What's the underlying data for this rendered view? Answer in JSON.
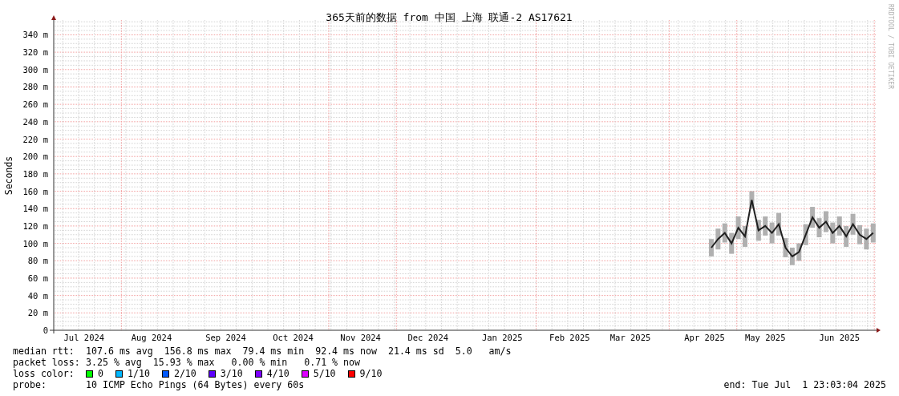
{
  "chart": {
    "watermark": "RRDTOOL / TOBI OETIKER",
    "chart_data": {
      "type": "line",
      "title": "365天前的数据 from 中国 上海 联通-2 AS17621",
      "ylabel": "Seconds",
      "ylim": [
        0,
        357
      ],
      "grid": true,
      "categories": [
        null,
        null,
        null,
        null,
        "Jul 2024",
        null,
        null,
        null,
        null,
        null,
        null,
        null,
        null,
        null,
        "Aug 2024",
        null,
        null,
        null,
        null,
        null,
        null,
        null,
        null,
        null,
        null,
        "Sep 2024",
        null,
        null,
        null,
        null,
        null,
        null,
        null,
        null,
        null,
        "Oct 2024",
        null,
        null,
        null,
        null,
        null,
        null,
        null,
        null,
        null,
        "Nov 2024",
        null,
        null,
        null,
        null,
        null,
        null,
        null,
        null,
        null,
        "Dec 2024",
        null,
        null,
        null,
        null,
        null,
        null,
        null,
        null,
        null,
        null,
        "Jan 2025",
        null,
        null,
        null,
        null,
        null,
        null,
        null,
        null,
        null,
        "Feb 2025",
        null,
        null,
        null,
        null,
        null,
        null,
        null,
        null,
        "Mar 2025",
        null,
        null,
        null,
        null,
        null,
        null,
        null,
        null,
        null,
        null,
        "Apr 2025",
        null,
        null,
        null,
        null,
        null,
        null,
        null,
        null,
        "May 2025",
        null,
        null,
        null,
        null,
        null,
        null,
        null,
        null,
        null,
        null,
        "Jun 2025",
        null,
        null,
        null,
        null,
        null
      ],
      "yticks": [
        {
          "value": 0,
          "label": "0"
        },
        {
          "value": 20,
          "label": "20 m"
        },
        {
          "value": 40,
          "label": "40 m"
        },
        {
          "value": 60,
          "label": "60 m"
        },
        {
          "value": 80,
          "label": "80 m"
        },
        {
          "value": 100,
          "label": "100 m"
        },
        {
          "value": 120,
          "label": "120 m"
        },
        {
          "value": 140,
          "label": "140 m"
        },
        {
          "value": 160,
          "label": "160 m"
        },
        {
          "value": 180,
          "label": "180 m"
        },
        {
          "value": 200,
          "label": "200 m"
        },
        {
          "value": 220,
          "label": "220 m"
        },
        {
          "value": 240,
          "label": "240 m"
        },
        {
          "value": 260,
          "label": "260 m"
        },
        {
          "value": 280,
          "label": "280 m"
        },
        {
          "value": 300,
          "label": "300 m"
        },
        {
          "value": 320,
          "label": "320 m"
        },
        {
          "value": 340,
          "label": "340 m"
        }
      ],
      "series": [
        {
          "color": "#202020",
          "values": [
            null,
            null,
            null,
            null,
            null,
            null,
            null,
            null,
            null,
            null,
            null,
            null,
            null,
            null,
            null,
            null,
            null,
            null,
            null,
            null,
            null,
            null,
            null,
            null,
            null,
            null,
            null,
            null,
            null,
            null,
            null,
            null,
            null,
            null,
            null,
            null,
            null,
            null,
            null,
            null,
            null,
            null,
            null,
            null,
            null,
            null,
            null,
            null,
            null,
            null,
            null,
            null,
            null,
            null,
            null,
            null,
            null,
            null,
            null,
            null,
            null,
            null,
            null,
            null,
            null,
            null,
            null,
            null,
            null,
            null,
            null,
            null,
            null,
            null,
            null,
            null,
            null,
            null,
            null,
            null,
            null,
            null,
            null,
            null,
            null,
            null,
            null,
            null,
            null,
            null,
            null,
            null,
            null,
            null,
            null,
            null,
            null,
            95,
            105,
            112,
            100,
            118,
            108,
            150,
            115,
            120,
            112,
            122,
            95,
            85,
            90,
            110,
            130,
            118,
            125,
            112,
            120,
            108,
            122,
            110,
            105,
            112
          ],
          "errors": [
            null,
            null,
            null,
            null,
            null,
            null,
            null,
            null,
            null,
            null,
            null,
            null,
            null,
            null,
            null,
            null,
            null,
            null,
            null,
            null,
            null,
            null,
            null,
            null,
            null,
            null,
            null,
            null,
            null,
            null,
            null,
            null,
            null,
            null,
            null,
            null,
            null,
            null,
            null,
            null,
            null,
            null,
            null,
            null,
            null,
            null,
            null,
            null,
            null,
            null,
            null,
            null,
            null,
            null,
            null,
            null,
            null,
            null,
            null,
            null,
            null,
            null,
            null,
            null,
            null,
            null,
            null,
            null,
            null,
            null,
            null,
            null,
            null,
            null,
            null,
            null,
            null,
            null,
            null,
            null,
            null,
            null,
            null,
            null,
            null,
            null,
            null,
            null,
            null,
            null,
            null,
            null,
            null,
            null,
            null,
            null,
            null,
            10,
            12,
            11,
            12,
            13,
            12,
            10,
            12,
            11,
            12,
            13,
            11,
            10,
            10,
            12,
            12,
            11,
            12,
            12,
            11,
            12,
            12,
            11,
            12,
            11
          ]
        }
      ]
    }
  },
  "legend": {
    "median_rtt": {
      "label": "median rtt:",
      "text": "107.6 ms avg  156.8 ms max  79.4 ms min  92.4 ms now  21.4 ms sd  5.0   am/s"
    },
    "packet_loss": {
      "label": "packet loss:",
      "text": "3.25 % avg  15.93 % max   0.00 % min   0.71 % now"
    },
    "loss_color": {
      "label": "loss color:",
      "items": [
        {
          "label": "0",
          "color": "#00ff00"
        },
        {
          "label": "1/10",
          "color": "#00b8ff"
        },
        {
          "label": "2/10",
          "color": "#0059ff"
        },
        {
          "label": "3/10",
          "color": "#5e00ff"
        },
        {
          "label": "4/10",
          "color": "#7e00ff"
        },
        {
          "label": "5/10",
          "color": "#dd00ff"
        },
        {
          "label": "9/10",
          "color": "#ff0000"
        }
      ]
    },
    "probe": {
      "label": "probe:",
      "text": "10 ICMP Echo Pings (64 Bytes) every 60s"
    },
    "end": "end: Tue Jul  1 23:03:04 2025"
  }
}
